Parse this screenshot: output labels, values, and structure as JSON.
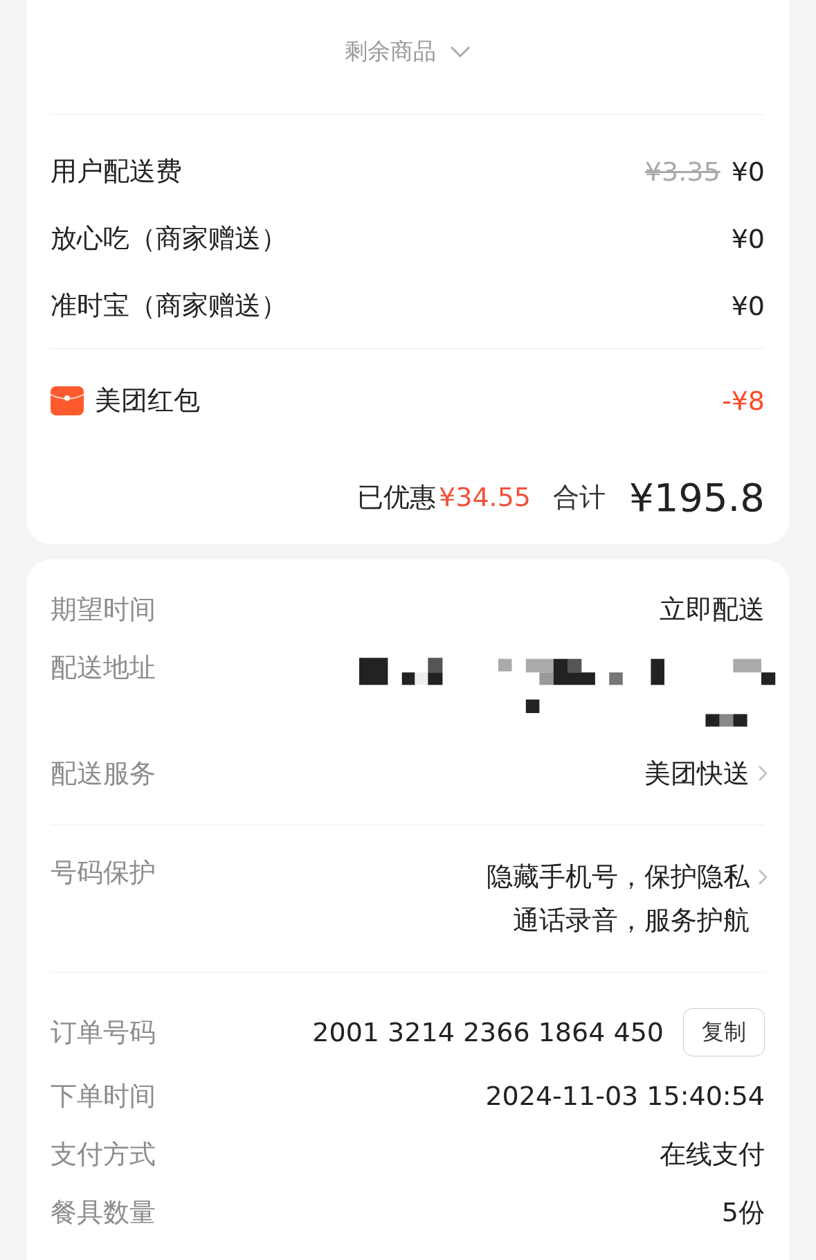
{
  "summary_card": {
    "more_items": {
      "label": "剩余商品",
      "expanded": false
    },
    "fees": [
      {
        "label": "用户配送费",
        "original_price": "¥3.35",
        "price": "¥0"
      },
      {
        "label": "放心吃（商家赠送）",
        "price": "¥0"
      },
      {
        "label": "准时宝（商家赠送）",
        "price": "¥0"
      }
    ],
    "red_packet": {
      "label": "美团红包",
      "amount": "-¥8"
    },
    "total": {
      "discount_label": "已优惠",
      "discount": "¥34.55",
      "total_label": "合计",
      "total": "¥195.8"
    }
  },
  "order_card": {
    "groups": [
      {
        "rows": [
          {
            "kind": "text",
            "label": "期望时间",
            "value": "立即配送"
          },
          {
            "kind": "address",
            "label": "配送地址"
          },
          {
            "kind": "link",
            "label": "配送服务",
            "lines": [
              "美团快送"
            ]
          }
        ]
      },
      {
        "rows": [
          {
            "kind": "link",
            "label": "号码保护",
            "lines": [
              "隐藏手机号，保护隐私",
              "通话录音，服务护航"
            ]
          }
        ]
      },
      {
        "rows": [
          {
            "kind": "copy",
            "label": "订单号码",
            "value": "2001 3214 2366 1864 450",
            "button": "复制"
          },
          {
            "kind": "text",
            "label": "下单时间",
            "value": "2024-11-03 15:40:54"
          },
          {
            "kind": "text",
            "label": "支付方式",
            "value": "在线支付"
          },
          {
            "kind": "text",
            "label": "餐具数量",
            "value": "5份"
          }
        ]
      }
    ]
  }
}
